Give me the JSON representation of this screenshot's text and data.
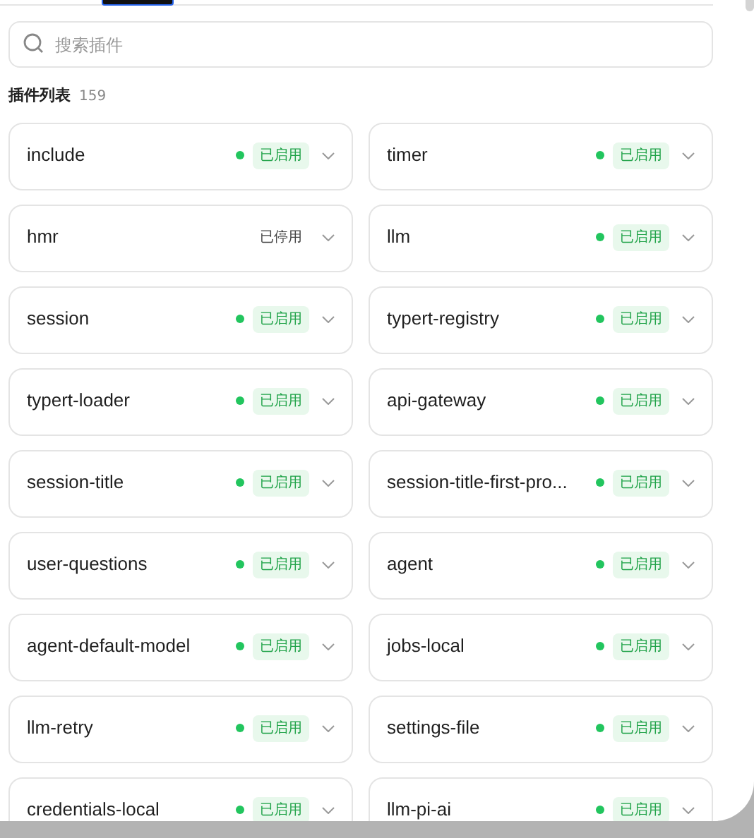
{
  "search": {
    "placeholder": "搜索插件"
  },
  "list_header": {
    "title": "插件列表",
    "count": "159"
  },
  "plugins": [
    {
      "name": "include",
      "enabled": true,
      "status": "已启用"
    },
    {
      "name": "timer",
      "enabled": true,
      "status": "已启用"
    },
    {
      "name": "hmr",
      "enabled": false,
      "status": "已停用"
    },
    {
      "name": "llm",
      "enabled": true,
      "status": "已启用"
    },
    {
      "name": "session",
      "enabled": true,
      "status": "已启用"
    },
    {
      "name": "typert-registry",
      "enabled": true,
      "status": "已启用"
    },
    {
      "name": "typert-loader",
      "enabled": true,
      "status": "已启用"
    },
    {
      "name": "api-gateway",
      "enabled": true,
      "status": "已启用"
    },
    {
      "name": "session-title",
      "enabled": true,
      "status": "已启用"
    },
    {
      "name": "session-title-first-pro...",
      "enabled": true,
      "status": "已启用"
    },
    {
      "name": "user-questions",
      "enabled": true,
      "status": "已启用"
    },
    {
      "name": "agent",
      "enabled": true,
      "status": "已启用"
    },
    {
      "name": "agent-default-model",
      "enabled": true,
      "status": "已启用"
    },
    {
      "name": "jobs-local",
      "enabled": true,
      "status": "已启用"
    },
    {
      "name": "llm-retry",
      "enabled": true,
      "status": "已启用"
    },
    {
      "name": "settings-file",
      "enabled": true,
      "status": "已启用"
    },
    {
      "name": "credentials-local",
      "enabled": true,
      "status": "已启用"
    },
    {
      "name": "llm-pi-ai",
      "enabled": true,
      "status": "已启用"
    }
  ]
}
